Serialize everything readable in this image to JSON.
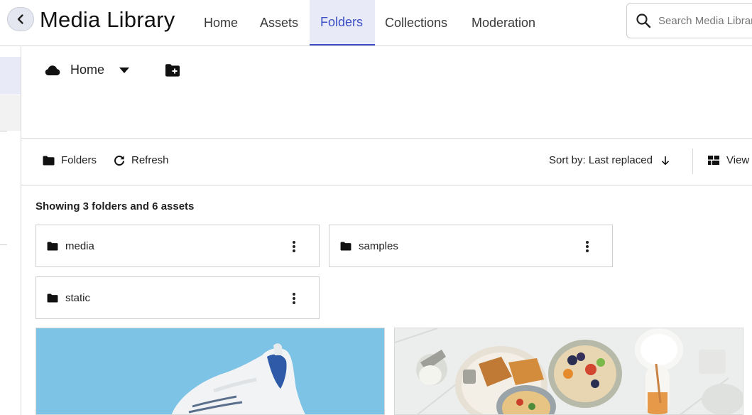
{
  "header": {
    "title": "Media Library",
    "tabs": [
      {
        "label": "Home",
        "active": false
      },
      {
        "label": "Assets",
        "active": false
      },
      {
        "label": "Folders",
        "active": true
      },
      {
        "label": "Collections",
        "active": false
      },
      {
        "label": "Moderation",
        "active": false
      }
    ],
    "search": {
      "placeholder": "Search Media Library",
      "value": ""
    }
  },
  "location": {
    "label": "Home",
    "icon": "cloud-icon"
  },
  "toolbar": {
    "folders_label": "Folders",
    "refresh_label": "Refresh",
    "sort_label": "Sort by: Last replaced",
    "view_label": "View"
  },
  "content": {
    "summary": "Showing 3 folders and 6 assets",
    "folders": [
      {
        "name": "media"
      },
      {
        "name": "samples"
      },
      {
        "name": "static"
      }
    ],
    "assets": [
      {
        "subject": "white sneaker on blue background"
      },
      {
        "subject": "breakfast table with bowls and waffles"
      }
    ]
  },
  "colors": {
    "accent": "#3d4fc4",
    "active_tab_bg": "#e8ebf7",
    "border": "#d8d8d8",
    "sneaker_bg": "#7cc3e6"
  }
}
